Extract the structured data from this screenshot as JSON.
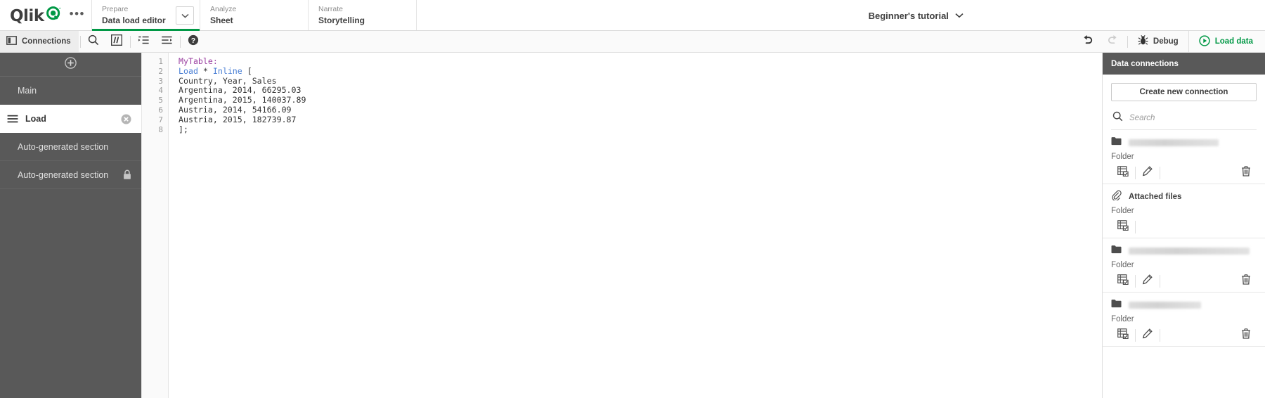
{
  "topnav": {
    "logo_text": "Qlik",
    "logo_mark": "q-logo-mark",
    "overflow_label": "•••",
    "items": [
      {
        "kicker": "Prepare",
        "label": "Data load editor",
        "active": true,
        "has_chevron": true
      },
      {
        "kicker": "Analyze",
        "label": "Sheet",
        "active": false,
        "has_chevron": false
      },
      {
        "kicker": "Narrate",
        "label": "Storytelling",
        "active": false,
        "has_chevron": false
      }
    ],
    "app_title": "Beginner's tutorial"
  },
  "toolbar": {
    "connections_label": "Connections",
    "search_title": "Search",
    "comment_title": "Comment/uncomment",
    "indent_title": "Indent",
    "outdent_title": "Outdent",
    "help_title": "Help",
    "undo_title": "Undo",
    "redo_title": "Redo",
    "debug_label": "Debug",
    "load_label": "Load data"
  },
  "sidebar": {
    "add_title": "Add new section",
    "sections": [
      {
        "name": "Main",
        "selected": false,
        "indent": true,
        "trailing": "none"
      },
      {
        "name": "Load",
        "selected": true,
        "indent": false,
        "trailing": "close"
      },
      {
        "name": "Auto-generated section",
        "selected": false,
        "indent": true,
        "trailing": "none"
      },
      {
        "name": "Auto-generated section",
        "selected": false,
        "indent": true,
        "trailing": "lock"
      }
    ]
  },
  "editor": {
    "line_numbers": [
      "1",
      "2",
      "3",
      "4",
      "5",
      "6",
      "7",
      "8"
    ],
    "lines": [
      [
        {
          "t": "MyTable:",
          "c": "tok-table"
        }
      ],
      [
        {
          "t": "Load",
          "c": "tok-kw"
        },
        {
          "t": " * ",
          "c": "tok-plain"
        },
        {
          "t": "Inline",
          "c": "tok-kw"
        },
        {
          "t": " [",
          "c": "tok-plain"
        }
      ],
      [
        {
          "t": "Country, Year, Sales",
          "c": "tok-plain"
        }
      ],
      [
        {
          "t": "Argentina, 2014, 66295.03",
          "c": "tok-plain"
        }
      ],
      [
        {
          "t": "Argentina, 2015, 140037.89",
          "c": "tok-plain"
        }
      ],
      [
        {
          "t": "Austria, 2014, 54166.09",
          "c": "tok-plain"
        }
      ],
      [
        {
          "t": "Austria, 2015, 182739.87",
          "c": "tok-plain"
        }
      ],
      [
        {
          "t": "];",
          "c": "tok-plain"
        }
      ]
    ]
  },
  "right_panel": {
    "title": "Data connections",
    "create_label": "Create new connection",
    "search_placeholder": "Search",
    "connections": [
      {
        "icon": "folder-icon",
        "name": "",
        "redacted": true,
        "redact_width": 128,
        "type": "Folder",
        "actions": [
          "select-data",
          "edit",
          "delete"
        ]
      },
      {
        "icon": "paperclip-icon",
        "name": "Attached files",
        "redacted": false,
        "redact_width": 0,
        "type": "Folder",
        "actions": [
          "select-data"
        ]
      },
      {
        "icon": "folder-icon",
        "name": "",
        "redacted": true,
        "redact_width": 172,
        "type": "Folder",
        "actions": [
          "select-data",
          "edit",
          "delete"
        ]
      },
      {
        "icon": "folder-icon",
        "name": "",
        "redacted": true,
        "redact_width": 103,
        "type": "Folder",
        "actions": [
          "select-data",
          "edit",
          "delete"
        ]
      }
    ]
  },
  "colors": {
    "accent_green": "#009845",
    "sidebar_bg": "#595959",
    "panel_header_bg": "#595959",
    "keyword_blue": "#4a7fd4",
    "table_purple": "#9a3fa0",
    "text_dark": "#404040"
  }
}
